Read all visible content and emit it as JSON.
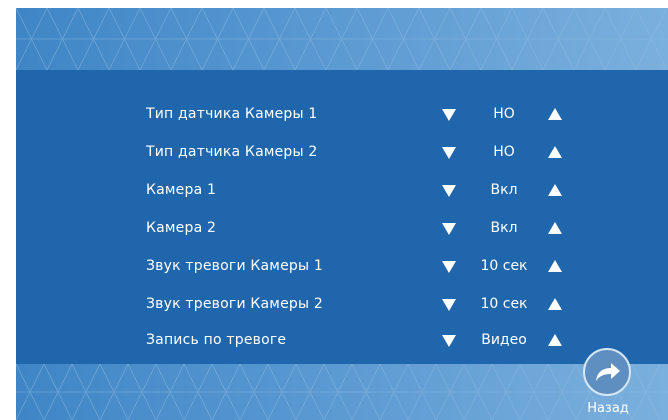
{
  "colors": {
    "panel_blue": "#1f66ad",
    "band_light": "#5c9ad2",
    "text": "#ffffff"
  },
  "settings": [
    {
      "label": "Тип датчика Камеры 1",
      "value": "НО"
    },
    {
      "label": "Тип датчика Камеры 2",
      "value": "НО"
    },
    {
      "label": "Камера 1",
      "value": "Вкл"
    },
    {
      "label": "Камера 2",
      "value": "Вкл"
    },
    {
      "label": "Звук тревоги Камеры 1",
      "value": "10 сек"
    },
    {
      "label": "Звук тревоги Камеры 2",
      "value": "10 сек"
    },
    {
      "label": "Запись по тревоге",
      "value": "Видео"
    }
  ],
  "icons": {
    "decrease": "triangle-down-icon",
    "increase": "triangle-up-icon",
    "back": "forward-arrow-icon"
  },
  "back": {
    "label": "Назад"
  }
}
